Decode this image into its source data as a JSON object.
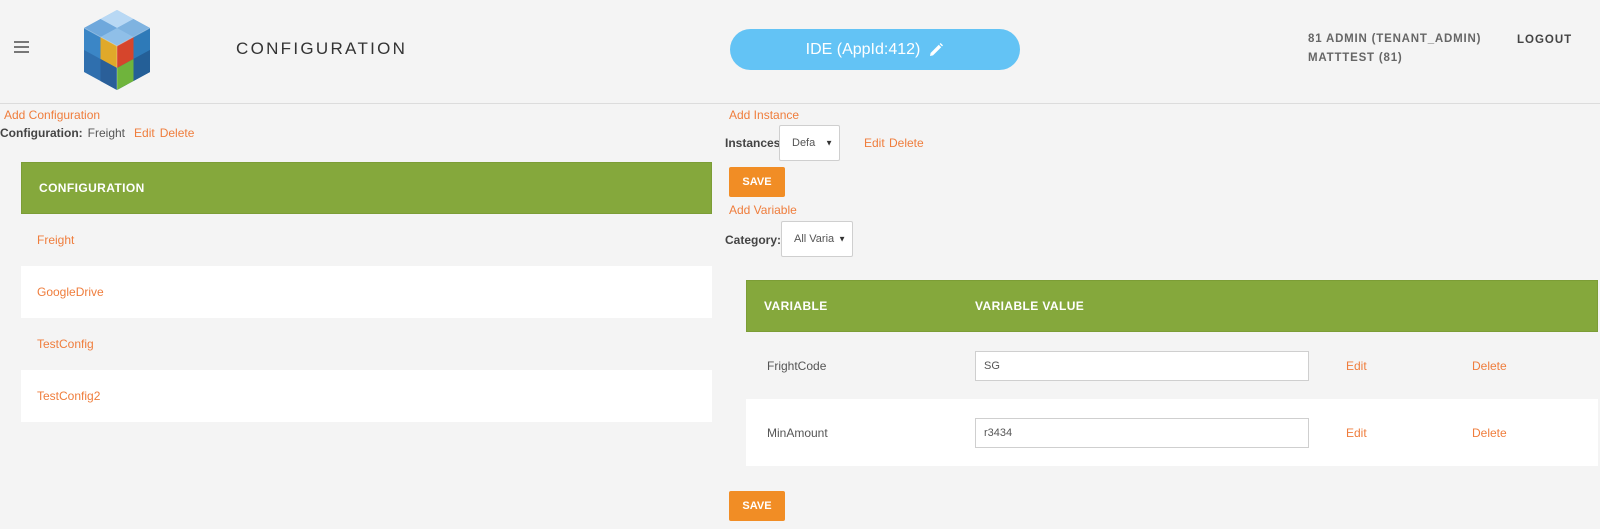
{
  "header": {
    "title": "CONFIGURATION",
    "app_pill": "IDE (AppId:412)",
    "user_line1": "81 ADMIN (TENANT_ADMIN)",
    "user_line2": "MATTTEST (81)",
    "logout": "LOGOUT"
  },
  "left": {
    "add_configuration": "Add Configuration",
    "config_label": "Configuration:",
    "config_value": "Freight",
    "edit": "Edit",
    "delete": "Delete",
    "table_header": "CONFIGURATION",
    "rows": [
      "Freight",
      "GoogleDrive",
      "TestConfig",
      "TestConfig2"
    ]
  },
  "right": {
    "add_instance": "Add Instance",
    "instances_label": "Instances",
    "instances_value": "Defa",
    "edit": "Edit",
    "delete": "Delete",
    "save": "SAVE",
    "add_variable": "Add Variable",
    "category_label": "Category:",
    "category_value": "All Varia",
    "table": {
      "col_variable": "VARIABLE",
      "col_value": "VARIABLE VALUE",
      "rows": [
        {
          "name": "FrightCode",
          "value": "SG",
          "edit": "Edit",
          "delete": "Delete"
        },
        {
          "name": "MinAmount",
          "value": "r3434",
          "edit": "Edit",
          "delete": "Delete"
        }
      ]
    },
    "save_bottom": "SAVE"
  },
  "colors": {
    "accent_link": "#ef7d3c",
    "table_header_green": "#85a83c",
    "save_orange": "#f18d25",
    "pill_blue": "#63c3f5"
  },
  "icons": {
    "menu": "hamburger-menu-icon",
    "logo": "cube-logo",
    "pencil": "pencil-icon",
    "caret": "caret-down-icon"
  }
}
